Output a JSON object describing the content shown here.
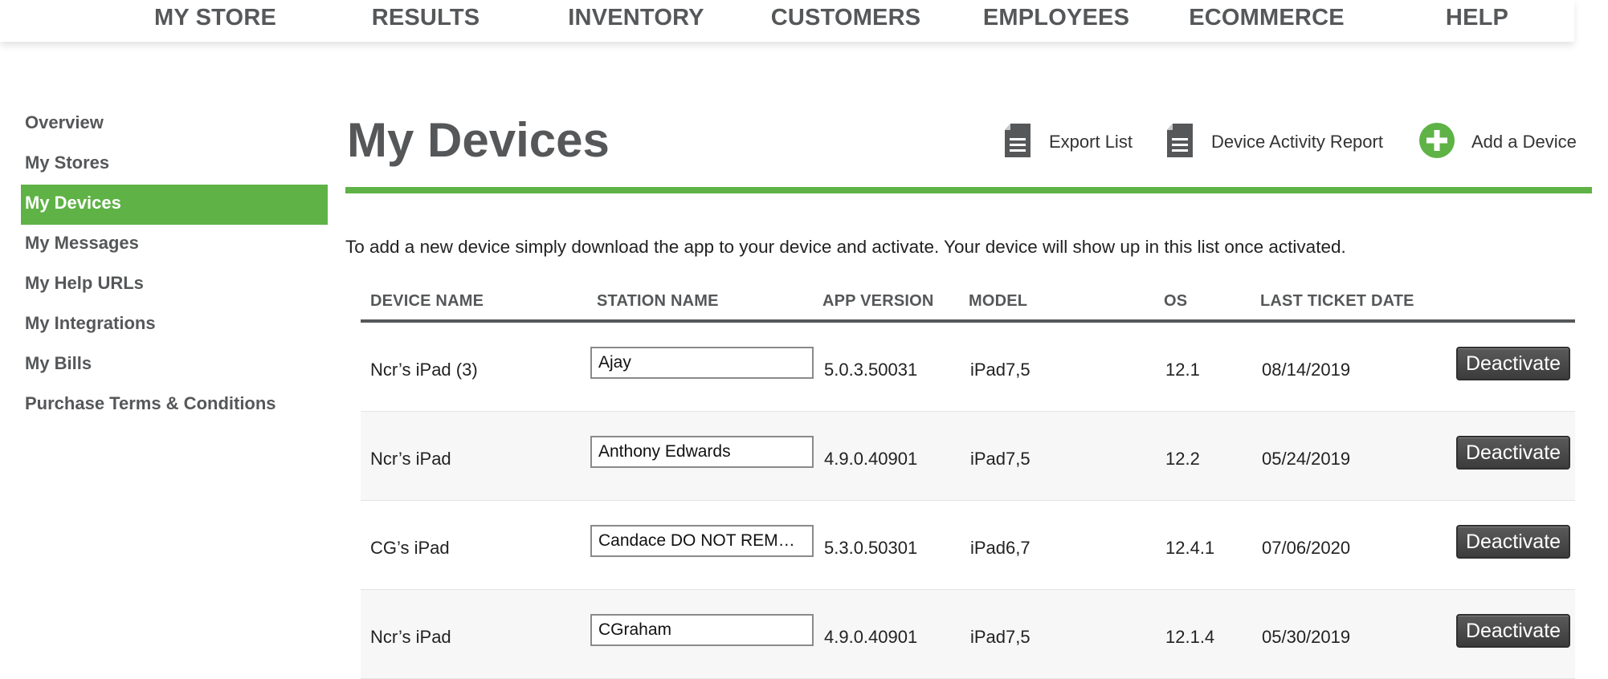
{
  "topnav": {
    "items": [
      "MY STORE",
      "RESULTS",
      "INVENTORY",
      "CUSTOMERS",
      "EMPLOYEES",
      "ECOMMERCE",
      "HELP"
    ]
  },
  "sidebar": {
    "items": [
      {
        "label": "Overview"
      },
      {
        "label": "My Stores"
      },
      {
        "label": "My Devices",
        "active": true
      },
      {
        "label": "My Messages"
      },
      {
        "label": "My Help URLs"
      },
      {
        "label": "My Integrations"
      },
      {
        "label": "My Bills"
      },
      {
        "label": "Purchase Terms & Conditions"
      }
    ]
  },
  "header": {
    "title": "My Devices",
    "actions": {
      "export": {
        "label": "Export List",
        "icon": "document-icon"
      },
      "report": {
        "label": "Device Activity Report",
        "icon": "document-icon"
      },
      "add": {
        "label": "Add a Device",
        "icon": "plus-circle-icon"
      }
    }
  },
  "intro": "To add a new device simply download the app to your device and activate. Your device will show up in this list once activated.",
  "table": {
    "columns": [
      "DEVICE NAME",
      "STATION NAME",
      "APP VERSION",
      "MODEL",
      "OS",
      "LAST TICKET DATE"
    ],
    "rows": [
      {
        "device": "Ncr’s iPad (3)",
        "station": "Ajay",
        "app_version": "5.0.3.50031",
        "model": "iPad7,5",
        "os": "12.1",
        "last_ticket": "08/14/2019",
        "action": "Deactivate"
      },
      {
        "device": "Ncr’s iPad",
        "station": "Anthony Edwards",
        "app_version": "4.9.0.40901",
        "model": "iPad7,5",
        "os": "12.2",
        "last_ticket": "05/24/2019",
        "action": "Deactivate"
      },
      {
        "device": "CG’s iPad",
        "station": "Candace DO NOT REMOVE",
        "app_version": "5.3.0.50301",
        "model": "iPad6,7",
        "os": "12.4.1",
        "last_ticket": "07/06/2020",
        "action": "Deactivate"
      },
      {
        "device": "Ncr’s iPad",
        "station": "CGraham",
        "app_version": "4.9.0.40901",
        "model": "iPad7,5",
        "os": "12.1.4",
        "last_ticket": "05/30/2019",
        "action": "Deactivate"
      }
    ]
  },
  "colors": {
    "accent_green": "#5fb246",
    "nav_gray": "#555759",
    "button_dark": "#444444"
  }
}
